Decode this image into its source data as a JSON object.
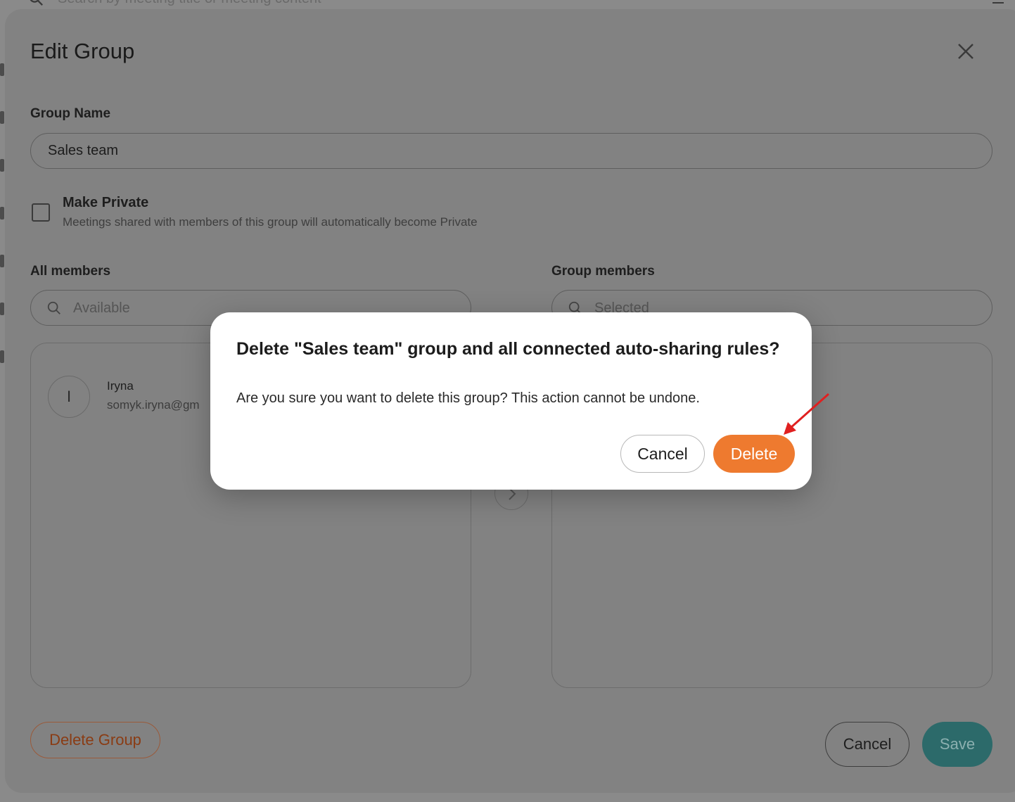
{
  "background": {
    "search_placeholder": "Search by meeting title or meeting content",
    "search_icon": "search-icon",
    "filter_icon": "filter-icon"
  },
  "modal": {
    "title": "Edit Group",
    "close_icon": "close-icon",
    "group_name_label": "Group Name",
    "group_name_value": "Sales team",
    "make_private": {
      "checked": false,
      "title": "Make Private",
      "description": "Meetings shared with members of this group will automatically become Private"
    },
    "all_members": {
      "label": "All members",
      "search_placeholder": "Available",
      "items": [
        {
          "initial": "I",
          "name": "Iryna",
          "email": "somyk.iryna@gm"
        }
      ]
    },
    "group_members": {
      "label": "Group members",
      "search_placeholder": "Selected"
    },
    "transfer_icon": "chevron-right-icon",
    "delete_group_label": "Delete Group",
    "cancel_label": "Cancel",
    "save_label": "Save"
  },
  "confirm_dialog": {
    "title": "Delete \"Sales team\" group and all connected auto-sharing rules?",
    "message": "Are you sure you want to delete this group? This action cannot be undone.",
    "cancel_label": "Cancel",
    "delete_label": "Delete"
  },
  "colors": {
    "accent_orange": "#ee7a2f",
    "save_teal": "#2c6a6a",
    "annotation_red": "#e02020"
  }
}
